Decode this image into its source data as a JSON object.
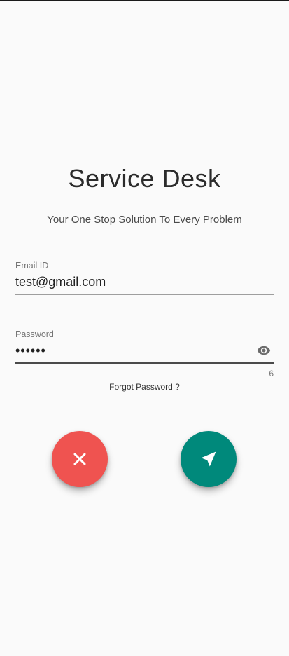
{
  "app": {
    "title": "Service Desk",
    "subtitle": "Your One Stop Solution To Every Problem"
  },
  "form": {
    "email": {
      "label": "Email ID",
      "value": "test@gmail.com"
    },
    "password": {
      "label": "Password",
      "value": "••••••",
      "char_count": "6"
    },
    "forgot_label": "Forgot Password ?"
  },
  "icons": {
    "visibility": "eye-icon",
    "cancel": "close-icon",
    "submit": "send-icon"
  },
  "colors": {
    "cancel_button": "#ef5350",
    "submit_button": "#00897b"
  }
}
